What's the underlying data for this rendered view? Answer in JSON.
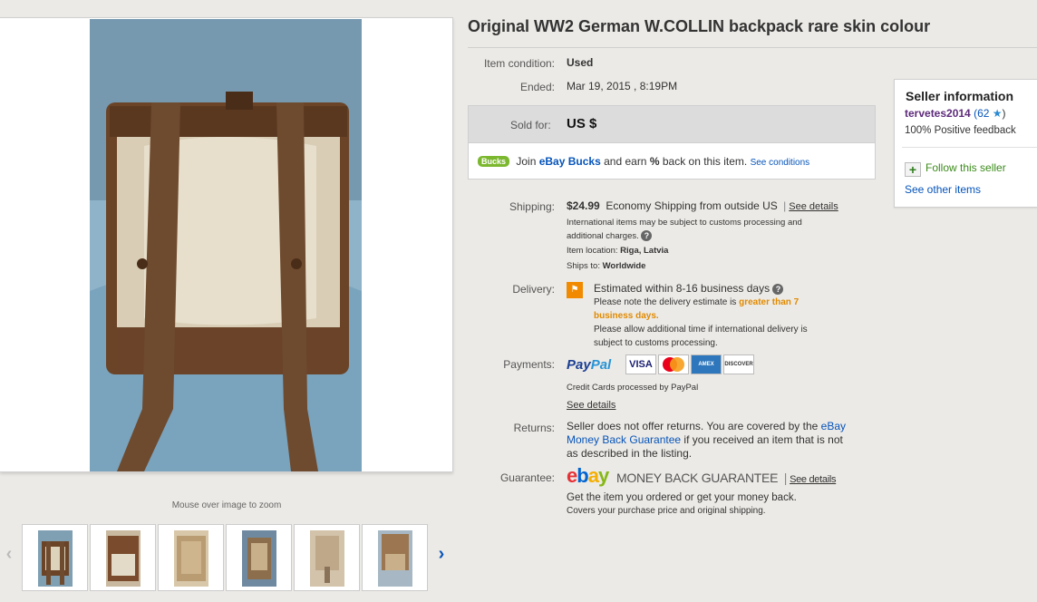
{
  "title": "Original WW2 German W.COLLIN backpack rare skin colour",
  "gallery": {
    "zoom_hint": "Mouse over image to zoom",
    "prev_arrow": "‹",
    "next_arrow": "›",
    "thumbnail_count": 6
  },
  "details": {
    "condition_label": "Item condition:",
    "condition_value": "Used",
    "ended_label": "Ended:",
    "ended_value": "Mar 19, 2015 , 8:19PM"
  },
  "sold": {
    "label": "Sold for:",
    "price": "US $",
    "bucks_badge": "Bucks",
    "bucks_join": "Join",
    "bucks_link": "eBay Bucks",
    "bucks_earn": "and earn",
    "bucks_percent": "%",
    "bucks_back": "back on this item.",
    "see_conditions": "See conditions"
  },
  "seller": {
    "heading": "Seller information",
    "username": "tervetes2014",
    "feedback_score": "(62",
    "feedback_close": ")",
    "positive_feedback": "100% Positive feedback",
    "follow": "Follow this seller",
    "other_items": "See other items"
  },
  "shipping": {
    "label": "Shipping:",
    "price": "$24.99",
    "method": "Economy Shipping from outside US",
    "see_details": "See details",
    "note_line1": "International items may be subject to customs processing and",
    "note_line2": "additional charges.",
    "location_label": "Item location:",
    "location_value": "Riga, Latvia",
    "ships_to_label": "Ships to:",
    "ships_to_value": "Worldwide"
  },
  "delivery": {
    "label": "Delivery:",
    "estimate": "Estimated within 8-16 business days",
    "note_prefix": "Please note the delivery estimate is",
    "note_highlight_1": "greater than 7",
    "note_highlight_2": "business days.",
    "note_line3": "Please allow additional time if international delivery is",
    "note_line4": "subject to customs processing."
  },
  "payments": {
    "label": "Payments:",
    "paypal_1": "Pay",
    "paypal_2": "Pal",
    "cards": [
      "VISA",
      "MC",
      "AMEX",
      "DISCOVER"
    ],
    "note": "Credit Cards processed by PayPal",
    "see_details": "See details"
  },
  "returns": {
    "label": "Returns:",
    "line1_text": "Seller does not offer returns. You are covered by the",
    "line1_link": "eBay",
    "line2_link": "Money Back Guarantee",
    "line2_text": "if you received an item that is not",
    "line3": "as described in the listing."
  },
  "guarantee": {
    "label": "Guarantee:",
    "logo_e": "e",
    "logo_b": "b",
    "logo_a": "a",
    "logo_y": "y",
    "mbg": "MONEY BACK GUARANTEE",
    "see_details": "See details",
    "line1": "Get the item you ordered or get your money back.",
    "line2": "Covers your purchase price and original shipping."
  },
  "colors": {
    "link": "#0654ba",
    "username": "#5d2b7a",
    "follow": "#3b8b1a",
    "highlight": "#e18a00"
  }
}
